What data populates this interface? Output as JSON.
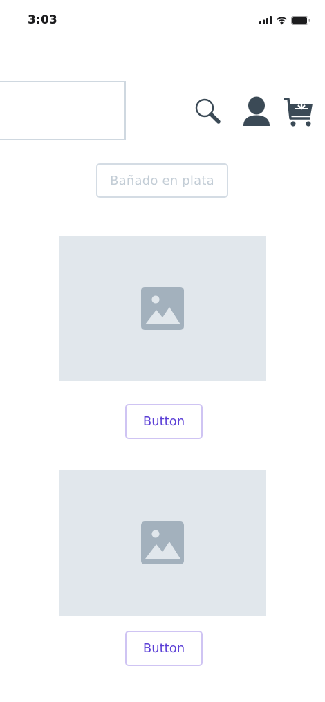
{
  "status_bar": {
    "time": "3:03",
    "icons": [
      "signal-icon",
      "wifi-icon",
      "battery-icon"
    ]
  },
  "header": {
    "icons": [
      "search-icon",
      "user-icon",
      "cart-icon"
    ],
    "icon_color": "#3b4a56"
  },
  "tag": {
    "label": "Bañado en plata"
  },
  "products": [
    {
      "image_icon": "image-icon",
      "button_label": "Button"
    },
    {
      "image_icon": "image-icon",
      "button_label": "Button"
    }
  ],
  "colors": {
    "placeholder_bg": "#e1e7ec",
    "placeholder_icon": "#a3b1bd",
    "accent": "#5b3fd6",
    "accent_border": "#cfc4f3",
    "tag_text": "#c3cdd6"
  }
}
